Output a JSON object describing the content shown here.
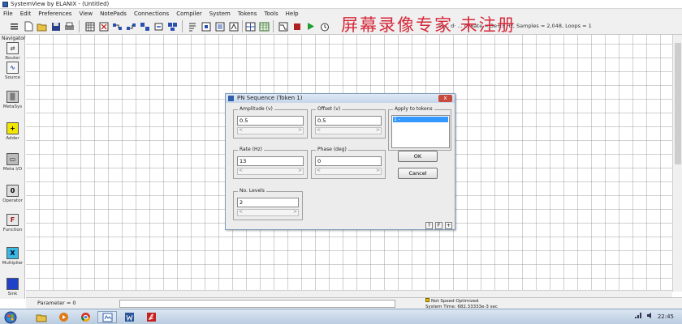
{
  "window": {
    "title": "SystemView by ELANIX - (Untitled)"
  },
  "menu": [
    "File",
    "Edit",
    "Preferences",
    "View",
    "NotePads",
    "Connections",
    "Compiler",
    "System",
    "Tokens",
    "Tools",
    "Help"
  ],
  "toolbar": {
    "sim_status": "sec, d· ... c, Rate = 3e+3 Hz,  Samples = 2,048,  Loops = 1"
  },
  "watermark": "屏幕录像专家 未注册",
  "navigator": {
    "title": "Navigator",
    "tokens": [
      {
        "label": "Router",
        "icon": "router-icon",
        "glyph": "⇄"
      },
      {
        "label": "Source",
        "icon": "source-icon",
        "glyph": "∿"
      },
      {
        "label": "MetaSys",
        "icon": "metasys-icon",
        "glyph": "▒"
      },
      {
        "label": "Adder",
        "icon": "adder-icon",
        "glyph": "+"
      },
      {
        "label": "Meta I/O",
        "icon": "meta-io-icon",
        "glyph": "▭"
      },
      {
        "label": "Operator",
        "icon": "operator-icon",
        "glyph": "0"
      },
      {
        "label": "Function",
        "icon": "function-icon",
        "glyph": "F"
      },
      {
        "label": "Multiplier",
        "icon": "multiplier-icon",
        "glyph": "X"
      },
      {
        "label": "Sink",
        "icon": "sink-icon",
        "glyph": "■"
      }
    ]
  },
  "status": {
    "parameter": "Parameter = 0",
    "speed": "Not Speed Optimized",
    "system_time": "System Time: 682.33333e-3 sec"
  },
  "taskbar": {
    "clock": "22:45",
    "apps": [
      "start",
      "explorer",
      "media",
      "chrome",
      "app",
      "word",
      "pdf"
    ]
  },
  "dialog": {
    "title": "PN Sequence (Token 1)",
    "close": "x",
    "amplitude": {
      "label": "Amplitude (v)",
      "value": "0.5"
    },
    "offset": {
      "label": "Offset (v)",
      "value": "0.5"
    },
    "apply": {
      "label": "Apply to tokens",
      "selected": "1 -"
    },
    "rate": {
      "label": "Rate (Hz)",
      "value": "13"
    },
    "phase": {
      "label": "Phase (deg)",
      "value": "0"
    },
    "levels": {
      "label": "No. Levels",
      "value": "2"
    },
    "ok": "OK",
    "cancel": "Cancel",
    "mini_buttons": [
      "?",
      "F",
      "+"
    ],
    "spin_left": "<",
    "spin_right": ">"
  },
  "colors": {
    "watermark": "#d6293a",
    "selection": "#3399ff",
    "play_green": "#1f9e2c",
    "stop_red": "#b02020"
  }
}
